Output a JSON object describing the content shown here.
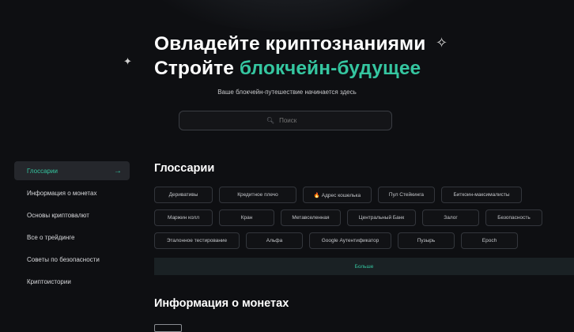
{
  "hero": {
    "title_line1": "Овладейте криптознаниями",
    "title_line2_prefix": "Стройте ",
    "title_line2_accent": "блокчейн-будущее",
    "subtitle": "Ваше блокчейн-путешествие начинается здесь"
  },
  "search": {
    "placeholder": "Поиск",
    "icon": "search-icon"
  },
  "sidebar": {
    "items": [
      {
        "label": "Глоссарии",
        "active": true,
        "icon": "arrow-right-icon"
      },
      {
        "label": "Информация о монетах"
      },
      {
        "label": "Основы криптовалют"
      },
      {
        "label": "Все о трейдинге"
      },
      {
        "label": "Советы по безопасности"
      },
      {
        "label": "Криптоистории"
      }
    ]
  },
  "glossary": {
    "title": "Глоссарии",
    "rows": [
      [
        "Деривативы",
        "Кредитное плечо",
        "🔥 Адрес кошелька",
        "Пул Стейкинга",
        "Биткоин-максималисты"
      ],
      [
        "Маржин колл",
        "Кран",
        "Метавселенная",
        "Центральный Банк",
        "Залог",
        "Безопасность"
      ],
      [
        "Эталонное тестирование",
        "Альфа",
        "Google Аутентификатор",
        "Пузырь",
        "Epoch"
      ]
    ],
    "more_label": "Больше"
  },
  "coins": {
    "title": "Информация о монетах"
  },
  "colors": {
    "accent": "#35c6a0",
    "background": "#0e0f12"
  }
}
